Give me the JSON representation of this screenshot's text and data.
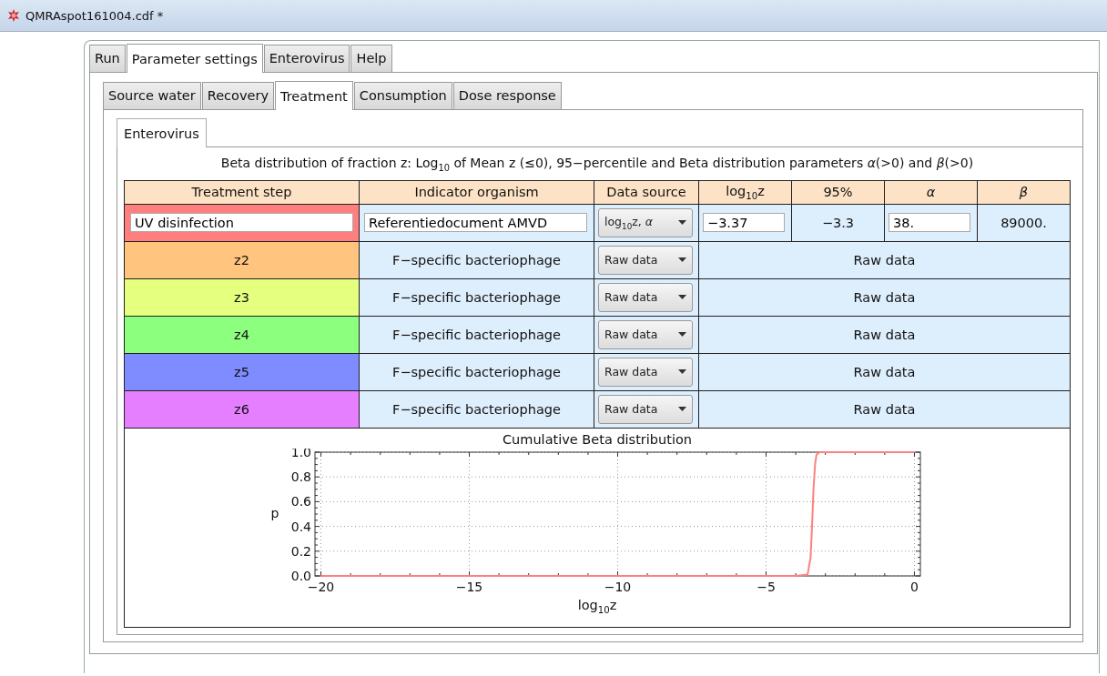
{
  "window": {
    "title": "QMRAspot161004.cdf *"
  },
  "tabs": [
    {
      "label": "Run",
      "selected": false
    },
    {
      "label": "Parameter settings",
      "selected": true
    },
    {
      "label": "Enterovirus",
      "selected": false
    },
    {
      "label": "Help",
      "selected": false
    }
  ],
  "subtabs": [
    {
      "label": "Source water",
      "selected": false
    },
    {
      "label": "Recovery",
      "selected": false
    },
    {
      "label": "Treatment",
      "selected": true
    },
    {
      "label": "Consumption",
      "selected": false
    },
    {
      "label": "Dose response",
      "selected": false
    }
  ],
  "pathogen_tabs": [
    {
      "label": "Enterovirus",
      "selected": true
    }
  ],
  "table": {
    "caption": "Beta distribution of fraction z: Log$_{10}$ of Mean z (≤0), 95−percentile and Beta distribution parameters *α*(>0) and *β*(>0)",
    "columns": [
      {
        "label": "Treatment step",
        "italic": false
      },
      {
        "label": "Indicator organism",
        "italic": false
      },
      {
        "label": "Data source",
        "italic": false
      },
      {
        "label": "log$_{10}$z",
        "italic": false
      },
      {
        "label": "95%",
        "italic": false
      },
      {
        "label": "α",
        "italic": true
      },
      {
        "label": "β",
        "italic": true
      }
    ],
    "rows": [
      {
        "kind": "parameters",
        "color": "#ff7f7f",
        "step": "UV disinfection",
        "organism": "Referentiedocument AMVD",
        "source": "log$_{10}$z, *α*",
        "log10z": "−3.37",
        "p95": "−3.3",
        "alpha": "38.",
        "beta": "89000."
      },
      {
        "kind": "raw",
        "color": "#ffc57f",
        "step": "z2",
        "organism": "F−specific bacteriophage",
        "source": "Raw data",
        "values": "Raw data"
      },
      {
        "kind": "raw",
        "color": "#e5ff7f",
        "step": "z3",
        "organism": "F−specific bacteriophage",
        "source": "Raw data",
        "values": "Raw data"
      },
      {
        "kind": "raw",
        "color": "#8cff7f",
        "step": "z4",
        "organism": "F−specific bacteriophage",
        "source": "Raw data",
        "values": "Raw data"
      },
      {
        "kind": "raw",
        "color": "#7f8cff",
        "step": "z5",
        "organism": "F−specific bacteriophage",
        "source": "Raw data",
        "values": "Raw data"
      },
      {
        "kind": "raw",
        "color": "#e67fff",
        "step": "z6",
        "organism": "F−specific bacteriophage",
        "source": "Raw data",
        "values": "Raw data"
      }
    ]
  },
  "chart": {
    "chart_data": {
      "type": "line",
      "title": "Cumulative Beta distribution",
      "xlabel": "log$_{10}$z",
      "ylabel": "p",
      "x": [
        -20,
        -4,
        -3.6,
        -3.5,
        -3.45,
        -3.4,
        -3.35,
        -3.3,
        -3.2,
        0
      ],
      "grid": true,
      "series": [
        {
          "color": "#ff8080",
          "values": [
            0,
            0,
            0.01,
            0.15,
            0.4,
            0.7,
            0.9,
            0.98,
            1,
            1
          ]
        }
      ],
      "xlim": [
        -20.2,
        0.2
      ],
      "ylim": [
        0,
        1
      ],
      "xticks": [
        {
          "value": -20,
          "label": "−20"
        },
        {
          "value": -15,
          "label": "−15"
        },
        {
          "value": -10,
          "label": "−10"
        },
        {
          "value": -5,
          "label": "−5"
        },
        {
          "value": 0,
          "label": "0"
        }
      ],
      "yticks": [
        {
          "value": 0,
          "label": "0.0"
        },
        {
          "value": 0.2,
          "label": "0.2"
        },
        {
          "value": 0.4,
          "label": "0.4"
        },
        {
          "value": 0.6,
          "label": "0.6"
        },
        {
          "value": 0.8,
          "label": "0.8"
        },
        {
          "value": 1,
          "label": "1.0"
        }
      ]
    }
  }
}
